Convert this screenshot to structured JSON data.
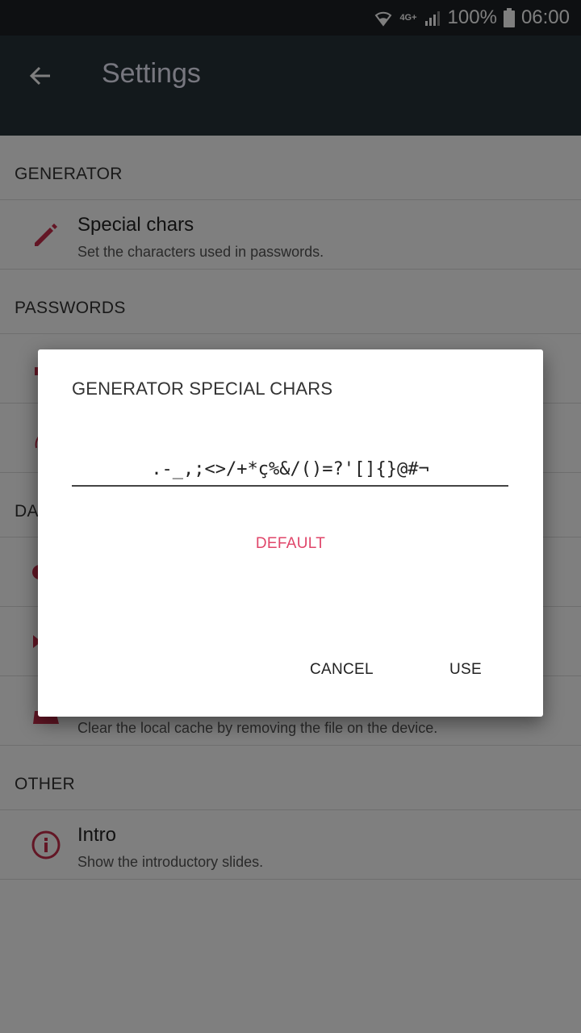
{
  "status_bar": {
    "network": "4G+",
    "battery_percent": "100%",
    "time": "06:00"
  },
  "app_bar": {
    "title": "Settings"
  },
  "sections": {
    "generator": {
      "header": "GENERATOR",
      "special_chars": {
        "title": "Special chars",
        "subtitle": "Set the characters used in passwords."
      }
    },
    "passwords": {
      "header": "PASSWORDS"
    },
    "data": {
      "header_visible": "DA",
      "clear_cache": {
        "subtitle": "Clear the local cache by removing the file on the device."
      }
    },
    "other": {
      "header": "OTHER",
      "intro": {
        "title": "Intro",
        "subtitle": "Show the introductory slides."
      }
    }
  },
  "dialog": {
    "title": "GENERATOR SPECIAL CHARS",
    "field_value": ".-_,;<>/+*ç%&/()=?'[]{}@#¬",
    "default_label": "DEFAULT",
    "cancel_label": "CANCEL",
    "use_label": "USE"
  },
  "colors": {
    "accent": "#e0466a",
    "icon_red": "#c62d4b",
    "appbar": "#263238",
    "statusbar": "#1d2125"
  }
}
